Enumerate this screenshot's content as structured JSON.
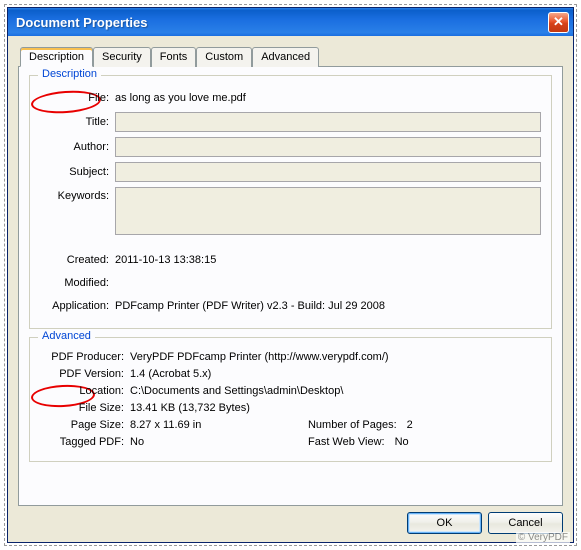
{
  "window": {
    "title": "Document Properties",
    "close_glyph": "✕"
  },
  "tabs": {
    "t0": "Description",
    "t1": "Security",
    "t2": "Fonts",
    "t3": "Custom",
    "t4": "Advanced"
  },
  "group_description": {
    "title": "Description",
    "labels": {
      "file": "File:",
      "title": "Title:",
      "author": "Author:",
      "subject": "Subject:",
      "keywords": "Keywords:",
      "created": "Created:",
      "modified": "Modified:",
      "application": "Application:"
    },
    "values": {
      "file": "as long as you love me.pdf",
      "title": "",
      "author": "",
      "subject": "",
      "keywords": "",
      "created": "2011-10-13 13:38:15",
      "modified": "",
      "application": "PDFcamp Printer (PDF Writer) v2.3 - Build: Jul 29 2008"
    }
  },
  "group_advanced": {
    "title": "Advanced",
    "labels": {
      "producer": "PDF Producer:",
      "version": "PDF Version:",
      "location": "Location:",
      "filesize": "File Size:",
      "pagesize": "Page Size:",
      "numpages": "Number of Pages:",
      "tagged": "Tagged PDF:",
      "fastweb": "Fast Web View:"
    },
    "values": {
      "producer": "VeryPDF PDFcamp Printer (http://www.verypdf.com/)",
      "version": "1.4 (Acrobat 5.x)",
      "location": "C:\\Documents and Settings\\admin\\Desktop\\",
      "filesize": "13.41 KB (13,732 Bytes)",
      "pagesize": "8.27 x 11.69 in",
      "numpages": "2",
      "tagged": "No",
      "fastweb": "No"
    }
  },
  "buttons": {
    "ok": "OK",
    "cancel": "Cancel"
  },
  "watermark": "© VeryPDF"
}
